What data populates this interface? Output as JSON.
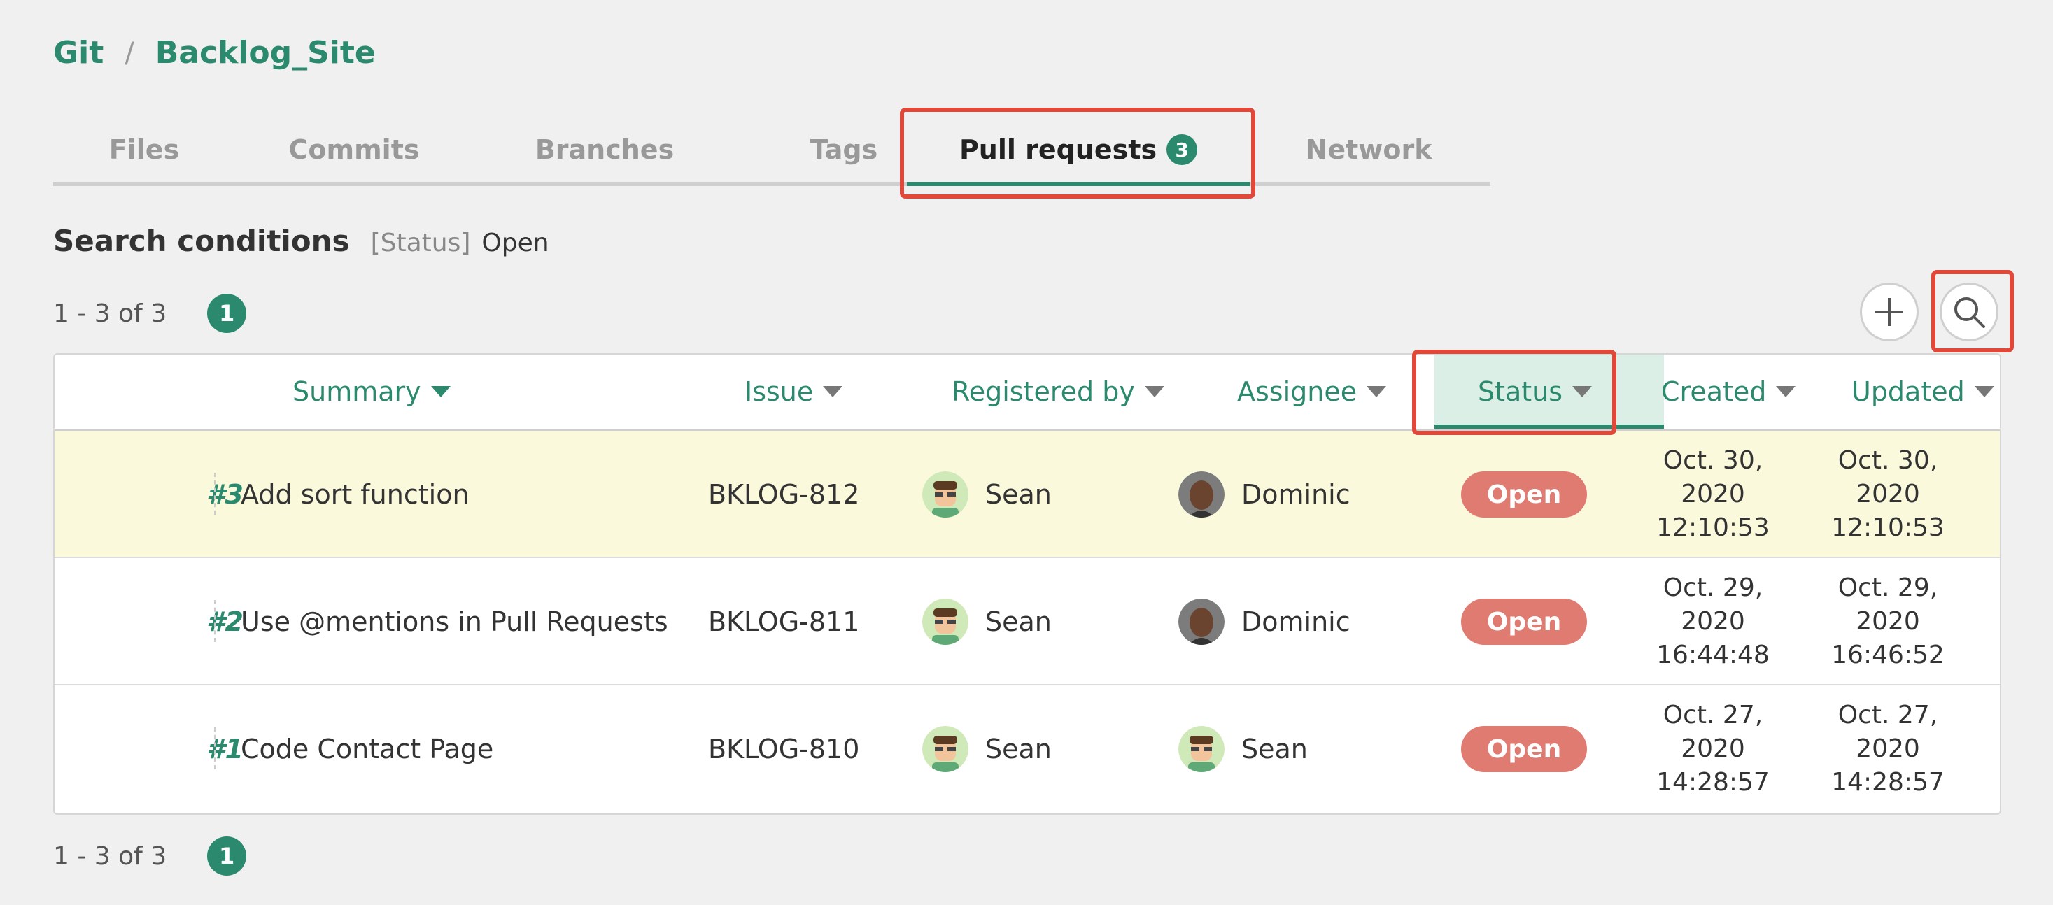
{
  "breadcrumb": {
    "root": "Git",
    "separator": "/",
    "project": "Backlog_Site"
  },
  "tabs": [
    {
      "label": "Files"
    },
    {
      "label": "Commits"
    },
    {
      "label": "Branches"
    },
    {
      "label": "Tags"
    },
    {
      "label": "Pull requests",
      "badge": "3",
      "active": true
    },
    {
      "label": "Network"
    }
  ],
  "search": {
    "title": "Search conditions",
    "key": "[Status]",
    "value": "Open"
  },
  "pagination": {
    "range_text": "1 - 3 of 3",
    "current_page": "1"
  },
  "toolbar": {
    "add_icon": "plus-icon",
    "search_icon": "search-icon"
  },
  "table": {
    "headers": {
      "summary": "Summary",
      "issue": "Issue",
      "registered_by": "Registered by",
      "assignee": "Assignee",
      "status": "Status",
      "created": "Created",
      "updated": "Updated"
    },
    "rows": [
      {
        "number": "#3",
        "summary": "Add sort function",
        "issue": "BKLOG-812",
        "registered_by": "Sean",
        "assignee": "Dominic",
        "status": "Open",
        "created_date": "Oct. 30, 2020",
        "created_time": "12:10:53",
        "updated_date": "Oct. 30,",
        "updated_year": "2020",
        "updated_time": "12:10:53"
      },
      {
        "number": "#2",
        "summary": "Use @mentions in Pull Requests",
        "issue": "BKLOG-811",
        "registered_by": "Sean",
        "assignee": "Dominic",
        "status": "Open",
        "created_date": "Oct. 29, 2020",
        "created_time": "16:44:48",
        "updated_date": "Oct. 29,",
        "updated_year": "2020",
        "updated_time": "16:46:52"
      },
      {
        "number": "#1",
        "summary": "Code Contact Page",
        "issue": "BKLOG-810",
        "registered_by": "Sean",
        "assignee": "Sean",
        "status": "Open",
        "created_date": "Oct. 27, 2020",
        "created_time": "14:28:57",
        "updated_date": "Oct. 27,",
        "updated_year": "2020",
        "updated_time": "14:28:57"
      }
    ]
  },
  "colors": {
    "accent": "#2b8a6e",
    "status_open": "#e07b72",
    "highlight_border": "#e0483a",
    "row_highlight": "#fbf9dc"
  }
}
